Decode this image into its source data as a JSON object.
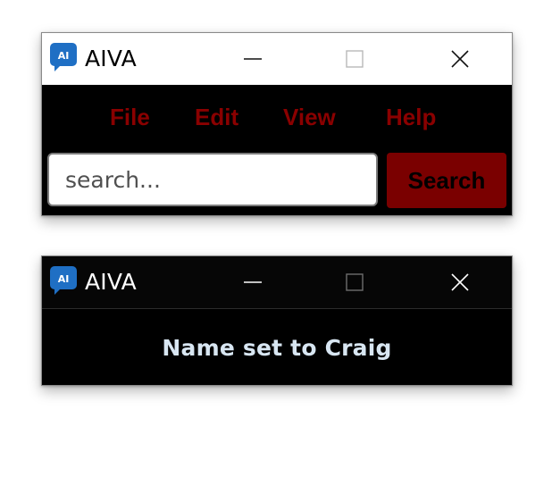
{
  "windows": [
    {
      "title": "AIVA",
      "icon": "aiva-app-icon",
      "controls": [
        "minimize-icon",
        "maximize-icon",
        "close-icon"
      ],
      "menu": [
        "File",
        "Edit",
        "View",
        "Help"
      ],
      "search": {
        "placeholder": "search...",
        "value": ""
      },
      "search_button_label": "Search"
    },
    {
      "title": "AIVA",
      "icon": "aiva-app-icon",
      "controls": [
        "minimize-icon",
        "maximize-icon",
        "close-icon"
      ],
      "message": "Name set to Craig"
    }
  ],
  "icon_text": "AI",
  "colors": {
    "menu_text": "#8a0000",
    "search_button_bg": "#7a0000",
    "message_text": "#d8e6f2",
    "app_icon_bg": "#1f6fc4"
  }
}
